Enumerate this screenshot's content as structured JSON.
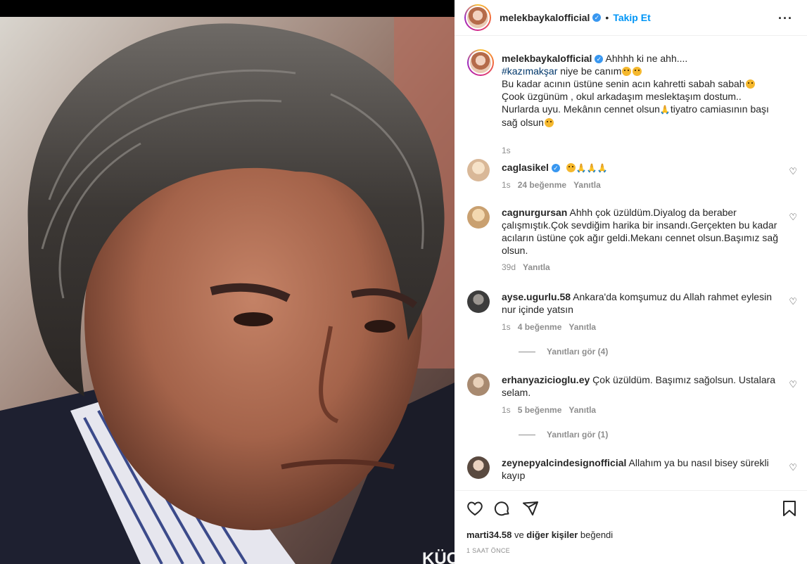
{
  "post": {
    "author": "melekbaykalofficial",
    "verified": true,
    "follow_label": "Takip Et",
    "separator": "•",
    "more_icon": "more-horizontal-icon",
    "caption_author": "melekbaykalofficial",
    "caption_line1": "Ahhhh ki ne ahh....",
    "caption_hashtag": "#kazımakşar",
    "caption_line2": " niye be canım",
    "caption_line3": "Bu kadar acının üstüne senin acın kahretti sabah sabah",
    "caption_line4": "Çook üzgünüm , okul arkadaşım meslektaşım dostum..",
    "caption_line5": "Nurlarda uyu. Mekânın cennet olsun",
    "caption_line5b": "tiyatro camiasının başı",
    "caption_line6": "sağ olsun",
    "caption_time": "1s"
  },
  "comments": [
    {
      "user": "caglasikel",
      "verified": true,
      "text": "",
      "time": "1s",
      "likes": "24 beğenme",
      "reply": "Yanıtla"
    },
    {
      "user": "cagnurgursan",
      "line1": "Ahhh çok üzüldüm.Diyalog da beraber",
      "line2": "çalışmıştık.Çok sevdiğim harika bir insandı.Gerçekten bu kadar",
      "line3": "acıların üstüne çok ağır geldi.Mekanı cennet olsun.Başımız sağ",
      "line4": "olsun.",
      "time": "39d",
      "reply": "Yanıtla"
    },
    {
      "user": "ayse.ugurlu.58",
      "line1": "Ankara'da komşumuz du Allah rahmet eylesin",
      "line2": "nur içinde yatsın",
      "time": "1s",
      "likes": "4 beğenme",
      "reply": "Yanıtla",
      "view_replies": "Yanıtları gör (4)"
    },
    {
      "user": "erhanyazicioglu.ey",
      "line1": "Çok üzüldüm. Başımız sağolsun. Ustalara",
      "line2": "selam.",
      "time": "1s",
      "likes": "5 beğenme",
      "reply": "Yanıtla",
      "view_replies": "Yanıtları gör (1)"
    },
    {
      "user": "zeynepyalcindesignofficial",
      "line1": "Allahım ya bu nasıl bisey sürekli",
      "line2": "kayıp"
    }
  ],
  "footer": {
    "liked_by_user": "marti34.58",
    "liked_and": " ve ",
    "liked_others": "diğer kişiler",
    "liked_suffix": " beğendi",
    "timestamp": "1 SAAT ÖNCE"
  },
  "photo": {
    "watermark": "KÜÇ"
  },
  "colors": {
    "accent": "#0095f6",
    "verified": "#3897f0",
    "muted": "#8e8e8e",
    "hashtag": "#00376b"
  }
}
